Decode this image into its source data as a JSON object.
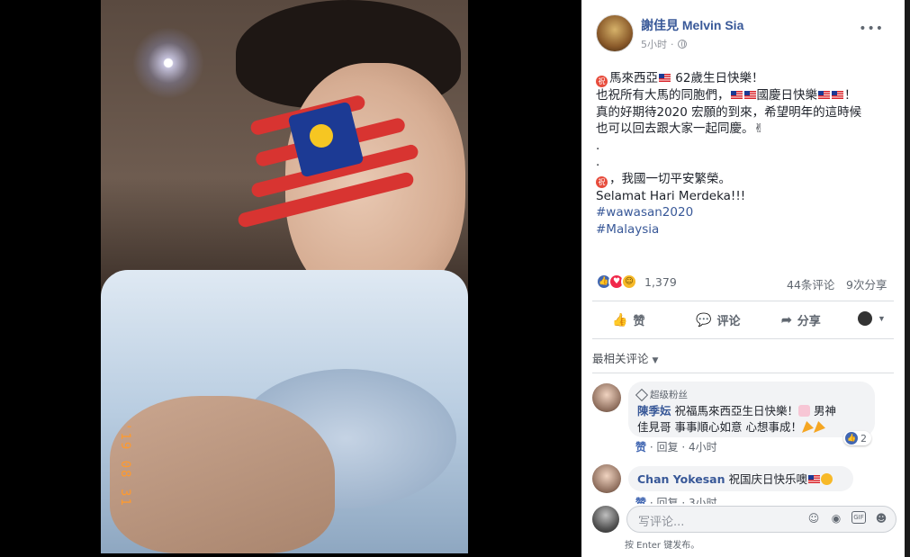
{
  "photo": {
    "timestamp_stamp": "'19 08 31"
  },
  "post": {
    "author": "謝佳見 Melvin Sia",
    "time": "5小时",
    "more_icon": "ellipsis-icon",
    "lines": {
      "l1": "馬來西亞",
      "l1b": " 62歲生日快樂！",
      "l2a": "也祝所有大馬的同胞們，",
      "l2b": "國慶日快樂",
      "l2c": "！",
      "l3": "真的好期待2020 宏願的到來，希望明年的這時候",
      "l4": "也可以回去跟大家一起同慶。✌",
      "l5": ".",
      "l6": ".",
      "l7": "，我國一切平安繁榮。",
      "l8": "Selamat Hari Merdeka!!!",
      "tag1": "#wawasan2020",
      "tag2": "#Malaysia"
    },
    "reaction_count": "1,379",
    "comment_count": "44条评论",
    "share_count": "9次分享"
  },
  "actions": {
    "like": "赞",
    "comment": "评论",
    "share": "分享"
  },
  "sort_label": "最相关评论",
  "comments": [
    {
      "badge": "超级粉丝",
      "name": "陳季妘",
      "text_a": "祝福馬來西亞生日快樂！",
      "text_b": " 男神",
      "text_c": "佳見哥 事事順心如意 心想事成！",
      "reactions": "2",
      "like": "赞",
      "reply": "回复",
      "time": "4小时"
    },
    {
      "name": "Chan Yokesan",
      "text": "祝国庆日快乐噢",
      "like": "赞",
      "reply": "回复",
      "time": "3小时"
    }
  ],
  "composer": {
    "placeholder": "写评论...",
    "hint": "按 Enter 键发布。",
    "icons": [
      "smiley-icon",
      "camera-icon",
      "gif-icon",
      "sticker-icon"
    ]
  },
  "colors": {
    "link": "#385898",
    "like_blue": "#4267b2",
    "text": "#1d2129",
    "muted": "#606770"
  }
}
